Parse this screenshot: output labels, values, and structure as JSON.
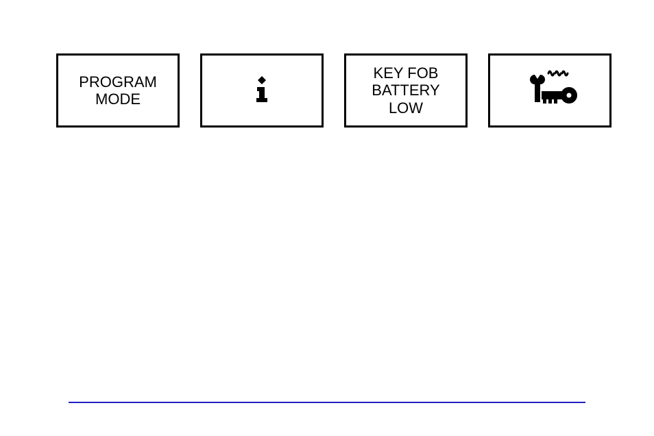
{
  "panels": [
    {
      "label": "PROGRAM\nMODE"
    },
    {
      "icon": "info-icon"
    },
    {
      "label": "KEY FOB\nBATTERY\nLOW"
    },
    {
      "icon": "wrench-key-signal-icon"
    }
  ]
}
